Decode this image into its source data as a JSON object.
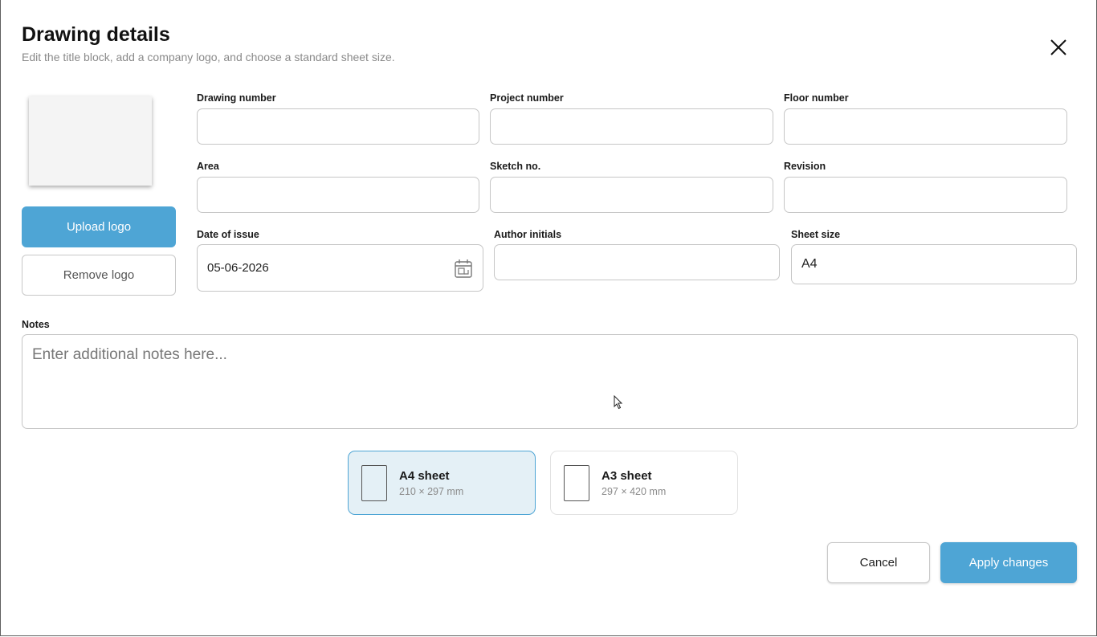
{
  "dialog": {
    "title": "Drawing details",
    "subtitle": "Edit the title block, add a company logo, and choose a standard sheet size.",
    "close_icon": "close-icon"
  },
  "logo": {
    "upload_label": "Upload logo",
    "remove_label": "Remove logo"
  },
  "fields": {
    "drawing_number": {
      "label": "Drawing number",
      "value": ""
    },
    "project_number": {
      "label": "Project number",
      "value": ""
    },
    "floor_number": {
      "label": "Floor number",
      "value": ""
    },
    "area": {
      "label": "Area",
      "value": ""
    },
    "sketch_no": {
      "label": "Sketch no.",
      "value": ""
    },
    "revision": {
      "label": "Revision",
      "value": ""
    },
    "date_of_issue": {
      "label": "Date of issue",
      "value": "05-06-2026",
      "icon": "calendar-icon"
    },
    "author_initials": {
      "label": "Author initials",
      "value": ""
    },
    "sheet_size": {
      "label": "Sheet size",
      "value": "A4"
    }
  },
  "notes": {
    "label": "Notes",
    "placeholder": "Enter additional notes here...",
    "value": ""
  },
  "sheets": [
    {
      "name": "A4 sheet",
      "dims": "210 × 297 mm",
      "selected": true
    },
    {
      "name": "A3 sheet",
      "dims": "297 × 420 mm",
      "selected": false
    }
  ],
  "footer": {
    "cancel_label": "Cancel",
    "apply_label": "Apply changes"
  },
  "colors": {
    "accent": "#4ea5d5",
    "selected_card_bg": "#e4f0f6"
  }
}
